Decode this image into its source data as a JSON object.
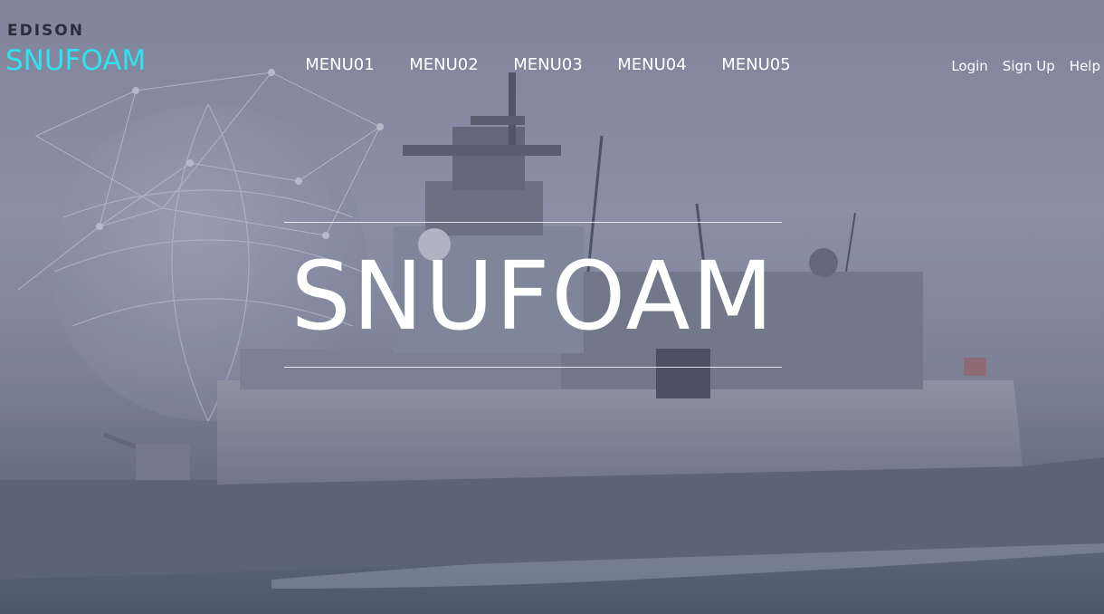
{
  "logo": {
    "edison": "EDISON",
    "snufoam": "SNUFOAM"
  },
  "nav": {
    "items": [
      "MENU01",
      "MENU02",
      "MENU03",
      "MENU04",
      "MENU05"
    ]
  },
  "util": {
    "login": "Login",
    "signup": "Sign Up",
    "help": "Help"
  },
  "hero": {
    "title": "SNUFOAM"
  },
  "colors": {
    "accent": "#2fe3ee",
    "text": "#ffffff",
    "sky": "#858aa1",
    "sea": "#4d566a"
  }
}
